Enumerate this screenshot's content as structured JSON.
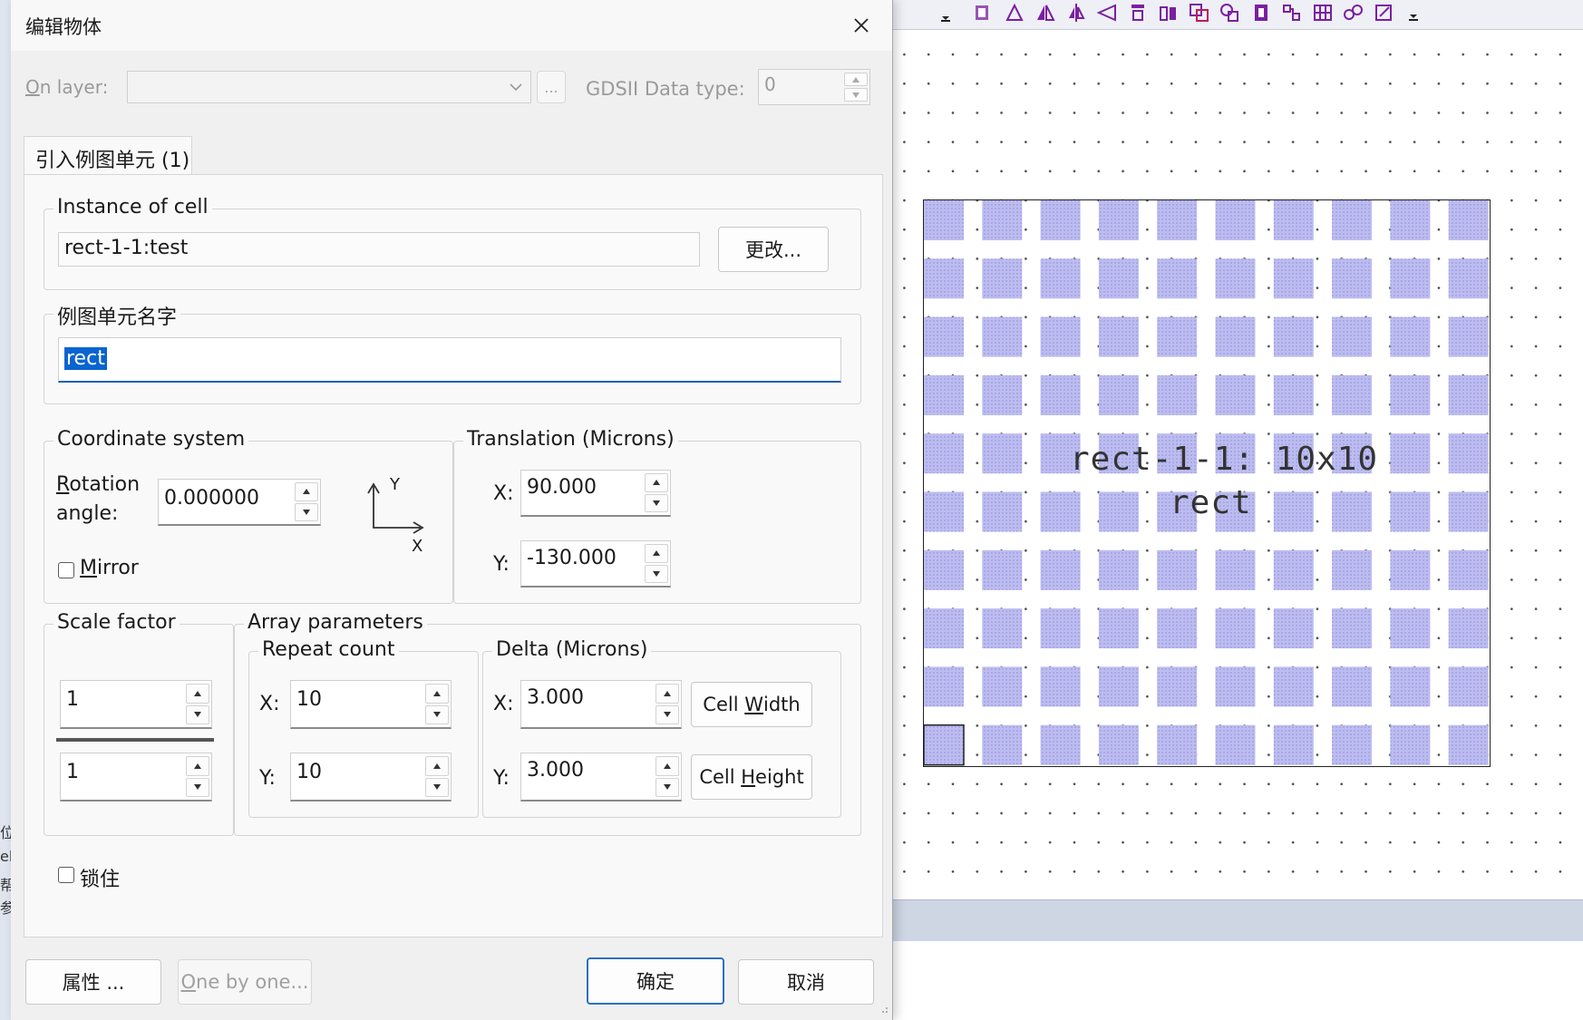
{
  "dialog": {
    "title": "编辑物体",
    "on_layer_prefix": "O",
    "on_layer_rest": "n layer:",
    "layer_value": "",
    "browse_button": "...",
    "gdsii_label": "GDSII Data type:",
    "gdsii_value": "0",
    "tab_label": "引入例图单元 (1)"
  },
  "instance_of_cell": {
    "group_label": "Instance of cell",
    "value": "rect-1-1:test",
    "change_button": "更改..."
  },
  "instance_name": {
    "group_label": "例图单元名字",
    "value": "rect"
  },
  "coordinate_system": {
    "group_label": "Coordinate system",
    "rotation_label_first": "R",
    "rotation_label_rest": "otation",
    "rotation_label_line2": "angle:",
    "rotation_value": "0.000000",
    "axis_y": "Y",
    "axis_x": "X",
    "mirror_prefix": "M",
    "mirror_rest": "irror",
    "mirror_checked": false
  },
  "translation": {
    "group_label": "Translation (Microns)",
    "x_label": "X:",
    "x_value": "90.000",
    "y_label": "Y:",
    "y_value": "-130.000"
  },
  "scale_factor": {
    "group_label": "Scale factor",
    "numerator": "1",
    "denominator": "1"
  },
  "array_parameters": {
    "group_label": "Array parameters",
    "repeat_count_label": "Repeat count",
    "repeat_x_label": "X:",
    "repeat_x_value": "10",
    "repeat_y_label": "Y:",
    "repeat_y_value": "10",
    "delta_label": "Delta (Microns)",
    "delta_x_label": "X:",
    "delta_x_value": "3.000",
    "delta_y_label": "Y:",
    "delta_y_value": "3.000",
    "cell_width_prefix": "Cell ",
    "cell_width_ul": "W",
    "cell_width_rest": "idth",
    "cell_height_prefix": "Cell ",
    "cell_height_ul": "H",
    "cell_height_rest": "eight"
  },
  "lock": {
    "label": "锁住",
    "checked": false
  },
  "footer": {
    "properties_button": "属性 ...",
    "one_by_one_prefix": "O",
    "one_by_one_rest": "ne by one...",
    "ok_button": "确定",
    "cancel_button": "取消"
  },
  "canvas": {
    "label_line1": "rect-1-1: 10x10",
    "label_line2": "rect",
    "array_rows": 10,
    "array_cols": 10,
    "fill_color": "#b9b9ee",
    "frame_color": "#222222"
  },
  "left_strip": {
    "fragments": [
      "位",
      "el",
      "帮",
      "参"
    ]
  },
  "colors": {
    "selection": "#0a64d0",
    "default_button_border": "#2f6ec2",
    "input_underline_focused": "#1a5fb4"
  }
}
